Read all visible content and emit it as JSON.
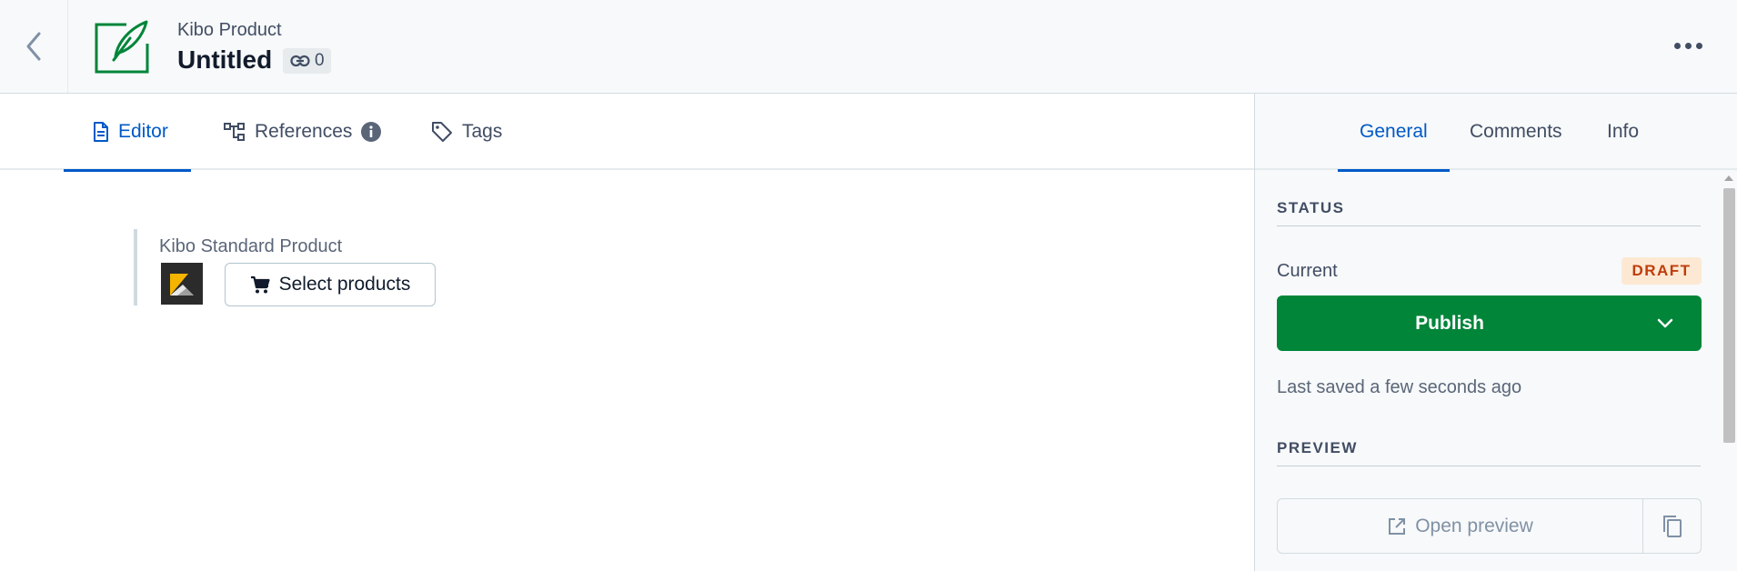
{
  "header": {
    "back_icon": "chevron-left-icon",
    "entry_icon": "feather-icon",
    "content_type": "Kibo Product",
    "title": "Untitled",
    "references_count": "0",
    "more_icon": "ellipsis-icon"
  },
  "editor_tabs": [
    {
      "label": "Editor",
      "icon": "document-icon",
      "active": true
    },
    {
      "label": "References",
      "icon": "hierarchy-icon",
      "info_icon": "info-icon",
      "active": false
    },
    {
      "label": "Tags",
      "icon": "tag-icon",
      "active": false
    }
  ],
  "field": {
    "label": "Kibo Standard Product",
    "logo": "kibo-logo",
    "button_label": "Select products",
    "button_icon": "cart-icon"
  },
  "sidebar": {
    "tabs": [
      {
        "label": "General",
        "active": true
      },
      {
        "label": "Comments",
        "active": false
      },
      {
        "label": "Info",
        "active": false
      }
    ],
    "status_heading": "STATUS",
    "current_label": "Current",
    "status_badge": "DRAFT",
    "publish_label": "Publish",
    "last_saved": "Last saved a few seconds ago",
    "preview_heading": "PREVIEW",
    "open_preview_label": "Open preview",
    "open_preview_icon": "external-link-icon",
    "copy_icon": "copy-icon"
  },
  "colors": {
    "accent": "#0059c8",
    "publish": "#008539",
    "draft_bg": "#fde9d3",
    "draft_text": "#bf3c0c"
  }
}
